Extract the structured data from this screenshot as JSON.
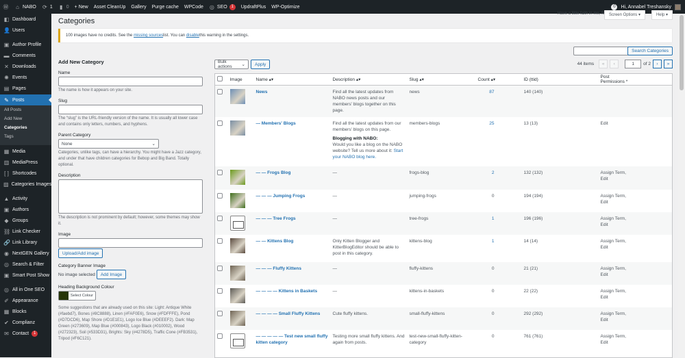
{
  "adminbar": {
    "site": "NABO",
    "updates": "1",
    "comments": "0",
    "new": "+ New",
    "links": [
      "Asset CleanUp",
      "Gallery",
      "Purge cache",
      "WPCode"
    ],
    "seo": "SEO",
    "seo_badge": "1",
    "links2": [
      "UpdraftPlus",
      "WP-Optimize"
    ],
    "notif": "0",
    "greeting": "Hi, Annabel Treshansky"
  },
  "sidebar": {
    "items": [
      {
        "label": "Dashboard",
        "icon": "dashboard-icon",
        "glyph": "◧"
      },
      {
        "label": "Users",
        "icon": "users-icon",
        "glyph": "👤"
      },
      {
        "label": "Author Profile",
        "icon": "author-icon",
        "glyph": "▣"
      },
      {
        "label": "Comments",
        "icon": "comments-icon",
        "glyph": "▬"
      },
      {
        "label": "Downloads",
        "icon": "downloads-icon",
        "glyph": "✕"
      },
      {
        "label": "Events",
        "icon": "events-icon",
        "glyph": "✺"
      },
      {
        "label": "Pages",
        "icon": "pages-icon",
        "glyph": "▤"
      },
      {
        "label": "Posts",
        "icon": "pin-icon",
        "glyph": "✎",
        "active": true
      },
      {
        "label": "Media",
        "icon": "media-icon",
        "glyph": "▦"
      },
      {
        "label": "MediaPress",
        "icon": "mediapress-icon",
        "glyph": "▥"
      },
      {
        "label": "Shortcodes",
        "icon": "shortcodes-icon",
        "glyph": "[ ]"
      },
      {
        "label": "Categories Images",
        "icon": "image-icon",
        "glyph": "▨"
      },
      {
        "label": "Activity",
        "icon": "activity-icon",
        "glyph": "▲"
      },
      {
        "label": "Authors",
        "icon": "authors-icon",
        "glyph": "▣"
      },
      {
        "label": "Groups",
        "icon": "groups-icon",
        "glyph": "◆"
      },
      {
        "label": "Link Checker",
        "icon": "link-checker-icon",
        "glyph": "⛓"
      },
      {
        "label": "Link Library",
        "icon": "link-icon",
        "glyph": "🔗"
      },
      {
        "label": "NextGEN Gallery",
        "icon": "nextgen-icon",
        "glyph": "◉"
      },
      {
        "label": "Search & Filter",
        "icon": "search-filter-icon",
        "glyph": "◎"
      },
      {
        "label": "Smart Post Show",
        "icon": "smart-post-icon",
        "glyph": "▣"
      },
      {
        "label": "All in One SEO",
        "icon": "aioseo-icon",
        "glyph": "◎"
      },
      {
        "label": "Appearance",
        "icon": "brush-icon",
        "glyph": "✐"
      },
      {
        "label": "Blocks",
        "icon": "blocks-icon",
        "glyph": "▦"
      },
      {
        "label": "Complianz",
        "icon": "check-icon",
        "glyph": "✔"
      },
      {
        "label": "Contact",
        "icon": "mail-icon",
        "glyph": "✉",
        "badge": "1"
      }
    ],
    "submenu": [
      "All Posts",
      "Add New",
      "Categories",
      "Tags"
    ]
  },
  "header": {
    "title": "Categories",
    "tagline": "Have a little faith in me, fellas",
    "screen_options": "Screen Options ▾",
    "help": "Help ▾"
  },
  "notice": {
    "pre": "100 images have no credits. See the ",
    "link1": "missing sources",
    "mid": " list. You can ",
    "link2": "disable",
    "post": " this warning in the settings."
  },
  "form": {
    "heading": "Add New Category",
    "name_label": "Name",
    "name_value": "",
    "name_help": "The name is how it appears on your site.",
    "slug_label": "Slug",
    "slug_value": "",
    "slug_help": "The “slug” is the URL-friendly version of the name. It is usually all lower case and contains only letters, numbers, and hyphens.",
    "parent_label": "Parent Category",
    "parent_value": "None",
    "parent_help": "Categories, unlike tags, can have a hierarchy. You might have a Jazz category, and under that have children categories for Bebop and Big Band. Totally optional.",
    "desc_label": "Description",
    "desc_help": "The description is not prominent by default; however, some themes may show it.",
    "image_label": "Image",
    "upload_btn": "Upload/Add image",
    "banner_label": "Category Banner Image",
    "banner_none": "No image selected",
    "add_image_btn": "Add Image",
    "heading_bg_label": "Heading Background Colour",
    "select_colour": "Select Colour",
    "heading_colour": "#273609",
    "suggestions": "Some suggestions that are already used on this site: Light: Antique White (#faebd7), Bones (#8C8888), Linen (#FAF0E6), Snow (#FDFFFE), Pond (#D7DCD6), Map Shore (#D1E1E1), Logo Ice Blue (#DEEEF2). Dark: Map Green (#273609), Map Blue (#000843), Logo Black (#010002), Wood (#272323), Soil (#533D31), Brights: Sky (#4278D5), Traffic Cone (#FB3531), Tripod (#F6C121)."
  },
  "table": {
    "search_btn": "Search Categories",
    "bulk": "Bulk actions",
    "apply": "Apply",
    "items": "44 items",
    "page": "1",
    "of": "of 2",
    "first": "«",
    "prev": "‹",
    "next": "›",
    "last": "»",
    "columns": [
      "Image",
      "Name ▴▾",
      "Description ▴▾",
      "Slug ▴▾",
      "Count ▴▾",
      "ID (ttid)",
      "Post Permissions *"
    ],
    "rows": [
      {
        "name": "News",
        "desc": "Find all the latest updates from NABO news posts and our members' blogs together on this page.",
        "slug": "news",
        "count": "87",
        "id": "140 (140)",
        "perm": "",
        "thumb": "#6d8fb5"
      },
      {
        "name": "— Members' Blogs",
        "desc": "Find all the latest updates from our members' blogs on this page.",
        "desc2": "Blogging with NABO:",
        "desc3": "Would you like a blog on the NABO website? Tell us more about it: ",
        "desc_link": "Start your NABO blog here.",
        "slug": "members-blogs",
        "count": "25",
        "id": "13 (13)",
        "perm": "Edit",
        "thumb": "#7a8ea3"
      },
      {
        "name": "— — Frogs Blog",
        "desc": "—",
        "slug": "frogs-blog",
        "count": "2",
        "id": "132 (132)",
        "perm": "Assign Term, Edit",
        "thumb": "#6b9a1c"
      },
      {
        "name": "— — — Jumping Frogs",
        "desc": "—",
        "slug": "jumping-frogs",
        "count": "0",
        "id": "194 (194)",
        "perm": "Assign Term, Edit",
        "thumb": "#3f6e1c"
      },
      {
        "name": "— — — Tree Frogs",
        "desc": "—",
        "slug": "tree-frogs",
        "count": "1",
        "id": "196 (196)",
        "perm": "Assign Term, Edit",
        "thumb": "sign"
      },
      {
        "name": "— — Kittens Blog",
        "desc": "Only Kitten Blogger and KitterBlogEditor should be able to post in this category.",
        "slug": "kittens-blog",
        "count": "1",
        "id": "14 (14)",
        "perm": "Assign Term, Edit",
        "thumb": "#5a4a3e"
      },
      {
        "name": "— — — Fluffy Kittens",
        "desc": "—",
        "slug": "fluffy-kittens",
        "count": "0",
        "id": "21 (21)",
        "perm": "Assign Term, Edit",
        "thumb": "#6e6353"
      },
      {
        "name": "— — — — Kittens in Baskets",
        "desc": "—",
        "slug": "kittens-in-baskets",
        "count": "0",
        "id": "22 (22)",
        "perm": "Assign Term, Edit",
        "thumb": "#5c5a55"
      },
      {
        "name": "— — — — Small Fluffy Kittens",
        "desc": "Cute fluffy kittens.",
        "slug": "small-fluffy-kittens",
        "count": "0",
        "id": "292 (292)",
        "perm": "Assign Term, Edit",
        "thumb": "#6e6353"
      },
      {
        "name": "— — — — — Test new small fluffy kitten category",
        "desc": "Testing more small fluffy kittens. And again from posts.",
        "slug": "test-new-small-fluffy-kitten-category",
        "count": "0",
        "id": "761 (761)",
        "perm": "Assign Term, Edit",
        "thumb": "sign"
      }
    ]
  }
}
